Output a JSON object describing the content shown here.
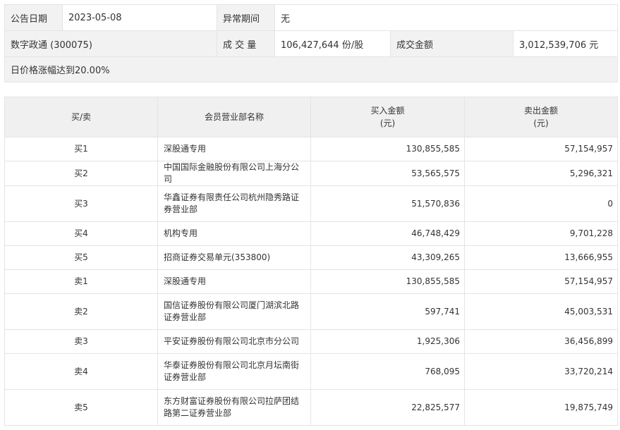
{
  "info": {
    "date_label": "公告日期",
    "date_value": "2023-05-08",
    "period_label": "异常期间",
    "period_value": "无",
    "stock_name": "数字政通 (300075)",
    "volume_label": "成 交 量",
    "volume_value": "106,427,644 份/股",
    "amount_label": "成交金额",
    "amount_value": "3,012,539,706 元",
    "reason": "日价格涨幅达到20.00%"
  },
  "detail": {
    "headers": {
      "side": "买/卖",
      "name": "会员营业部名称",
      "buy_line1": "买入金额",
      "buy_line2": "(元)",
      "sell_line1": "卖出金额",
      "sell_line2": "(元)"
    },
    "rows": [
      {
        "side": "买1",
        "name": "深股通专用",
        "buy": "130,855,585",
        "sell": "57,154,957"
      },
      {
        "side": "买2",
        "name": "中国国际金融股份有限公司上海分公司",
        "buy": "53,565,575",
        "sell": "5,296,321"
      },
      {
        "side": "买3",
        "name": "华鑫证券有限责任公司杭州隐秀路证券营业部",
        "buy": "51,570,836",
        "sell": "0"
      },
      {
        "side": "买4",
        "name": "机构专用",
        "buy": "46,748,429",
        "sell": "9,701,228"
      },
      {
        "side": "买5",
        "name": "招商证券交易单元(353800)",
        "buy": "43,309,265",
        "sell": "13,666,955"
      },
      {
        "side": "卖1",
        "name": "深股通专用",
        "buy": "130,855,585",
        "sell": "57,154,957"
      },
      {
        "side": "卖2",
        "name": "国信证券股份有限公司厦门湖滨北路证券营业部",
        "buy": "597,741",
        "sell": "45,003,531"
      },
      {
        "side": "卖3",
        "name": "平安证券股份有限公司北京市分公司",
        "buy": "1,925,306",
        "sell": "36,456,899"
      },
      {
        "side": "卖4",
        "name": "华泰证券股份有限公司北京月坛南街证券营业部",
        "buy": "768,095",
        "sell": "33,720,214"
      },
      {
        "side": "卖5",
        "name": "东方财富证券股份有限公司拉萨团结路第二证券营业部",
        "buy": "22,825,577",
        "sell": "19,875,749"
      }
    ]
  }
}
